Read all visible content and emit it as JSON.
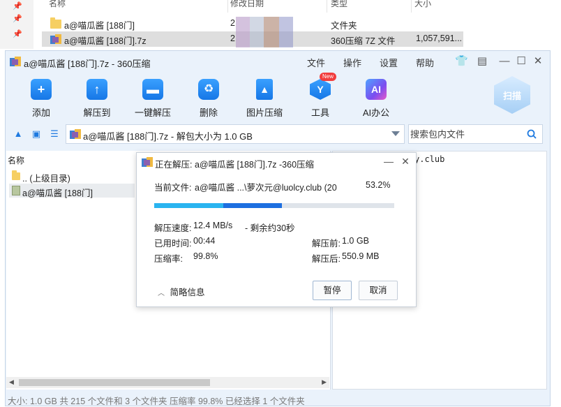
{
  "explorer": {
    "columns": {
      "name": "名称",
      "modified": "修改日期",
      "type": "类型",
      "size": "大小"
    },
    "rows": [
      {
        "name": "a@喵瓜酱 [188门]",
        "date": "2",
        "type": "文件夹",
        "size": ""
      },
      {
        "name": "a@喵瓜酱 [188门].7z",
        "date": "2",
        "type": "360压缩 7Z 文件",
        "size": "1,057,591..."
      }
    ]
  },
  "window": {
    "title": "a@喵瓜酱 [188门].7z - 360压缩",
    "menu": [
      "文件",
      "操作",
      "设置",
      "帮助"
    ]
  },
  "toolbar": {
    "items": [
      {
        "label": "添加",
        "icon": "add-icon"
      },
      {
        "label": "解压到",
        "icon": "extract-to-icon"
      },
      {
        "label": "一键解压",
        "icon": "one-click-extract-icon"
      },
      {
        "label": "删除",
        "icon": "delete-icon"
      },
      {
        "label": "图片压缩",
        "icon": "image-compress-icon"
      },
      {
        "label": "工具",
        "icon": "tools-icon"
      },
      {
        "label": "AI办公",
        "icon": "ai-office-icon"
      }
    ],
    "new_badge": "New",
    "scan_label": "扫描"
  },
  "address": {
    "path": "a@喵瓜酱 [188门].7z - 解包大小为 1.0 GB",
    "search_placeholder": "搜索包内文件"
  },
  "left_pane": {
    "header": "名称",
    "items": [
      {
        "label": ".. (上级目录)"
      },
      {
        "label": "a@喵瓜酱 [188门]"
      }
    ]
  },
  "right_pane": {
    "text": "y.club"
  },
  "status_bar": "大小: 1.0 GB 共 215 个文件和 3 个文件夹 压缩率 99.8% 已经选择 1 个文件夹",
  "dialog": {
    "title": "正在解压: a@喵瓜酱 [188门].7z -360压缩",
    "current_file_label": "当前文件:",
    "current_file": "a@喵瓜酱 ...\\萝次元@luolcy.club (20",
    "percent": "53.2%",
    "progress": 0.532,
    "speed_label": "解压速度:",
    "speed": "12.4 MB/s",
    "remaining": "- 剩余约30秒",
    "elapsed_label": "已用时间:",
    "elapsed": "00:44",
    "ratio_label": "压缩率:",
    "ratio": "99.8%",
    "before_label": "解压前:",
    "before": "1.0 GB",
    "after_label": "解压后:",
    "after": "550.9 MB",
    "brief_info": "简略信息",
    "pause_button": "暂停",
    "cancel_button": "取消"
  },
  "colors": {
    "accent": "#1677e6",
    "progress_light": "#2ab4f0",
    "progress_dark": "#1d6fe0",
    "window_bg": "#eaf2fb"
  }
}
